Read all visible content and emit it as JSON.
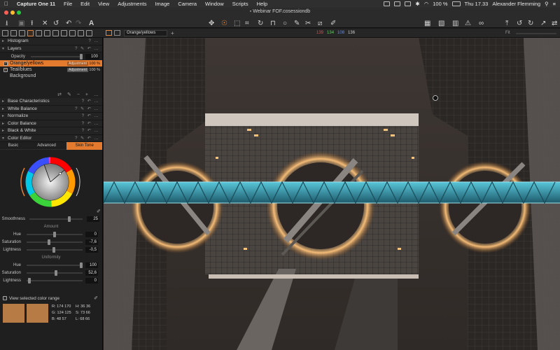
{
  "menubar": {
    "app_name": "Capture One 11",
    "items": [
      "File",
      "Edit",
      "View",
      "Adjustments",
      "Image",
      "Camera",
      "Window",
      "Scripts",
      "Help"
    ],
    "battery": "100 %",
    "clock": "Thu 17.33",
    "user": "Alexander Flemming"
  },
  "window": {
    "title": "Webinar FOF.cosessiondb"
  },
  "toolbar": {
    "left_icons": [
      "import-icon",
      "camera-icon",
      "export-icon",
      "close-x-icon",
      "undo-all-icon",
      "undo-icon",
      "redo-icon",
      "text-a-icon"
    ],
    "center_icons": [
      "pan-icon",
      "loupe-icon",
      "crop-icon",
      "straighten-icon",
      "keystone-icon",
      "spot-icon",
      "brush-icon",
      "eraser-icon",
      "gradient-icon",
      "picker-icon"
    ],
    "right_icons": [
      "grid-view-icon",
      "overlay-icon",
      "grid-icon",
      "exposure-warning-icon",
      "glasses-icon",
      "copy-icon",
      "rotate-icon",
      "redo-icon",
      "expand-icon",
      "flip-icon"
    ]
  },
  "viewer_bar": {
    "layer_select": "Orange/yellows",
    "readout": {
      "r": "139",
      "g": "134",
      "b": "108",
      "l": "136"
    },
    "zoom_label": "Fit"
  },
  "panel": {
    "histogram_label": "Histogram",
    "layers_label": "Layers",
    "opacity_label": "Opacity",
    "opacity_value": "100",
    "layers": [
      {
        "name": "Orange/yellows",
        "badge": "Adjustment",
        "pct": "100 %",
        "selected": true,
        "checked": true
      },
      {
        "name": "Teal/blues",
        "badge": "Adjustment",
        "pct": "100 %",
        "selected": false,
        "checked": true
      },
      {
        "name": "Background",
        "badge": "",
        "pct": "",
        "selected": false,
        "checked": false
      }
    ],
    "tools": [
      "Base Characteristics",
      "White Balance",
      "Normalize",
      "Color Balance",
      "Black & White",
      "Color Editor"
    ],
    "color_editor": {
      "tabs": [
        "Basic",
        "Advanced",
        "Skin Tone"
      ],
      "active_tab": "Skin Tone",
      "smoothness_label": "Smoothness",
      "smoothness_value": "25",
      "amount_title": "Amount",
      "uniformity_title": "Uniformity",
      "amount": [
        {
          "label": "Hue",
          "value": "0"
        },
        {
          "label": "Saturation",
          "value": "-7,6"
        },
        {
          "label": "Lightness",
          "value": "-0,5"
        }
      ],
      "uniformity": [
        {
          "label": "Hue",
          "value": "100"
        },
        {
          "label": "Saturation",
          "value": "52,6"
        },
        {
          "label": "Lightness",
          "value": "0"
        }
      ],
      "view_selected_label": "View selected color range",
      "swatch_color": "#b77c45",
      "readout": {
        "r_label": "R:",
        "r1": "174",
        "r2": "170",
        "g_label": "G:",
        "g1": "124",
        "g2": "125",
        "b_label": "B:",
        "b1": "48",
        "b2": "57",
        "h_label": "H:",
        "h1": "36",
        "h2": "36",
        "s_label": "S:",
        "s1": "73",
        "s2": "66",
        "l_label": "L:",
        "l1": "68",
        "l2": "66"
      }
    }
  },
  "colors": {
    "accent": "#e37a2e",
    "panel_bg": "#1f1f1f",
    "image_glow": "#f2b46a",
    "image_teal": "#3aa0b8"
  }
}
